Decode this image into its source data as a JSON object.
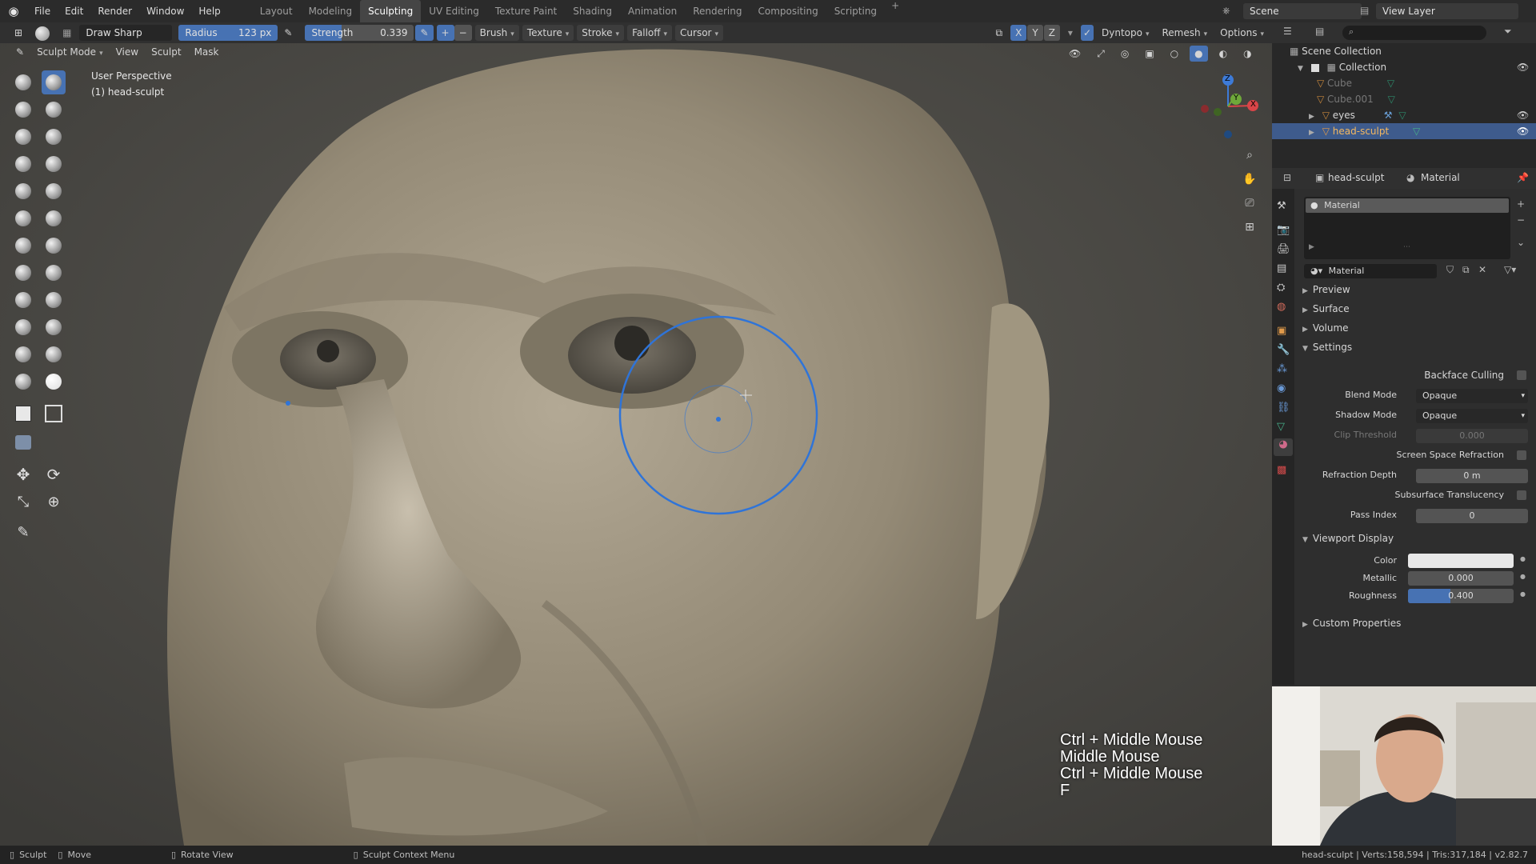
{
  "topbar": {
    "menus": [
      "File",
      "Edit",
      "Render",
      "Window",
      "Help"
    ],
    "workspaces": [
      "Layout",
      "Modeling",
      "Sculpting",
      "UV Editing",
      "Texture Paint",
      "Shading",
      "Animation",
      "Rendering",
      "Compositing",
      "Scripting"
    ],
    "active_workspace": "Sculpting",
    "plus": "+",
    "scene": "Scene",
    "view_layer": "View Layer"
  },
  "toolheader": {
    "brush_name": "Draw Sharp",
    "radius_label": "Radius",
    "radius_value": "123 px",
    "strength_label": "Strength",
    "strength_value": "0.339",
    "plus": "+",
    "minus": "−",
    "brush": "Brush",
    "texture": "Texture",
    "stroke": "Stroke",
    "falloff": "Falloff",
    "cursor": "Cursor",
    "x": "X",
    "y": "Y",
    "z": "Z",
    "dyntopo": "Dyntopo",
    "remesh": "Remesh",
    "options": "Options"
  },
  "vpheader": {
    "mode": "Sculpt Mode",
    "view": "View",
    "sculpt": "Sculpt",
    "mask": "Mask"
  },
  "viewport": {
    "perspective": "User Perspective",
    "object": "(1) head-sculpt",
    "gizmo_x": "X",
    "gizmo_y": "Y",
    "gizmo_z": "Z"
  },
  "outliner": {
    "root": "Scene Collection",
    "collection": "Collection",
    "items": [
      "Cube",
      "Cube.001",
      "eyes",
      "head-sculpt"
    ],
    "selected": "head-sculpt"
  },
  "properties": {
    "object": "head-sculpt",
    "material_tab": "Material",
    "slot": "Material",
    "material_name": "Material",
    "panels": {
      "preview": "Preview",
      "surface": "Surface",
      "volume": "Volume",
      "settings": "Settings",
      "viewport_display": "Viewport Display",
      "custom_properties": "Custom Properties"
    },
    "settings": {
      "backface_culling": "Backface Culling",
      "blend_mode_label": "Blend Mode",
      "blend_mode": "Opaque",
      "shadow_mode_label": "Shadow Mode",
      "shadow_mode": "Opaque",
      "clip_threshold_label": "Clip Threshold",
      "clip_threshold": "0.000",
      "ssr": "Screen Space Refraction",
      "refraction_depth_label": "Refraction Depth",
      "refraction_depth": "0 m",
      "sss": "Subsurface Translucency",
      "pass_index_label": "Pass Index",
      "pass_index": "0"
    },
    "viewport_display": {
      "color_label": "Color",
      "metallic_label": "Metallic",
      "metallic": "0.000",
      "roughness_label": "Roughness",
      "roughness": "0.400",
      "roughness_fraction": 0.4
    }
  },
  "overlay_keys": [
    "Ctrl + Middle Mouse",
    "Middle Mouse",
    "Ctrl + Middle Mouse",
    "F"
  ],
  "statusbar": {
    "sculpt": "Sculpt",
    "move": "Move",
    "rotate_view": "Rotate View",
    "context_menu": "Sculpt Context Menu",
    "stats": "head-sculpt | Verts:158,594 | Tris:317,184 | v2.82.7"
  },
  "colors": {
    "accent": "#4772b3",
    "brush_circle": "#2f74d8",
    "skin": "#a69c88"
  }
}
